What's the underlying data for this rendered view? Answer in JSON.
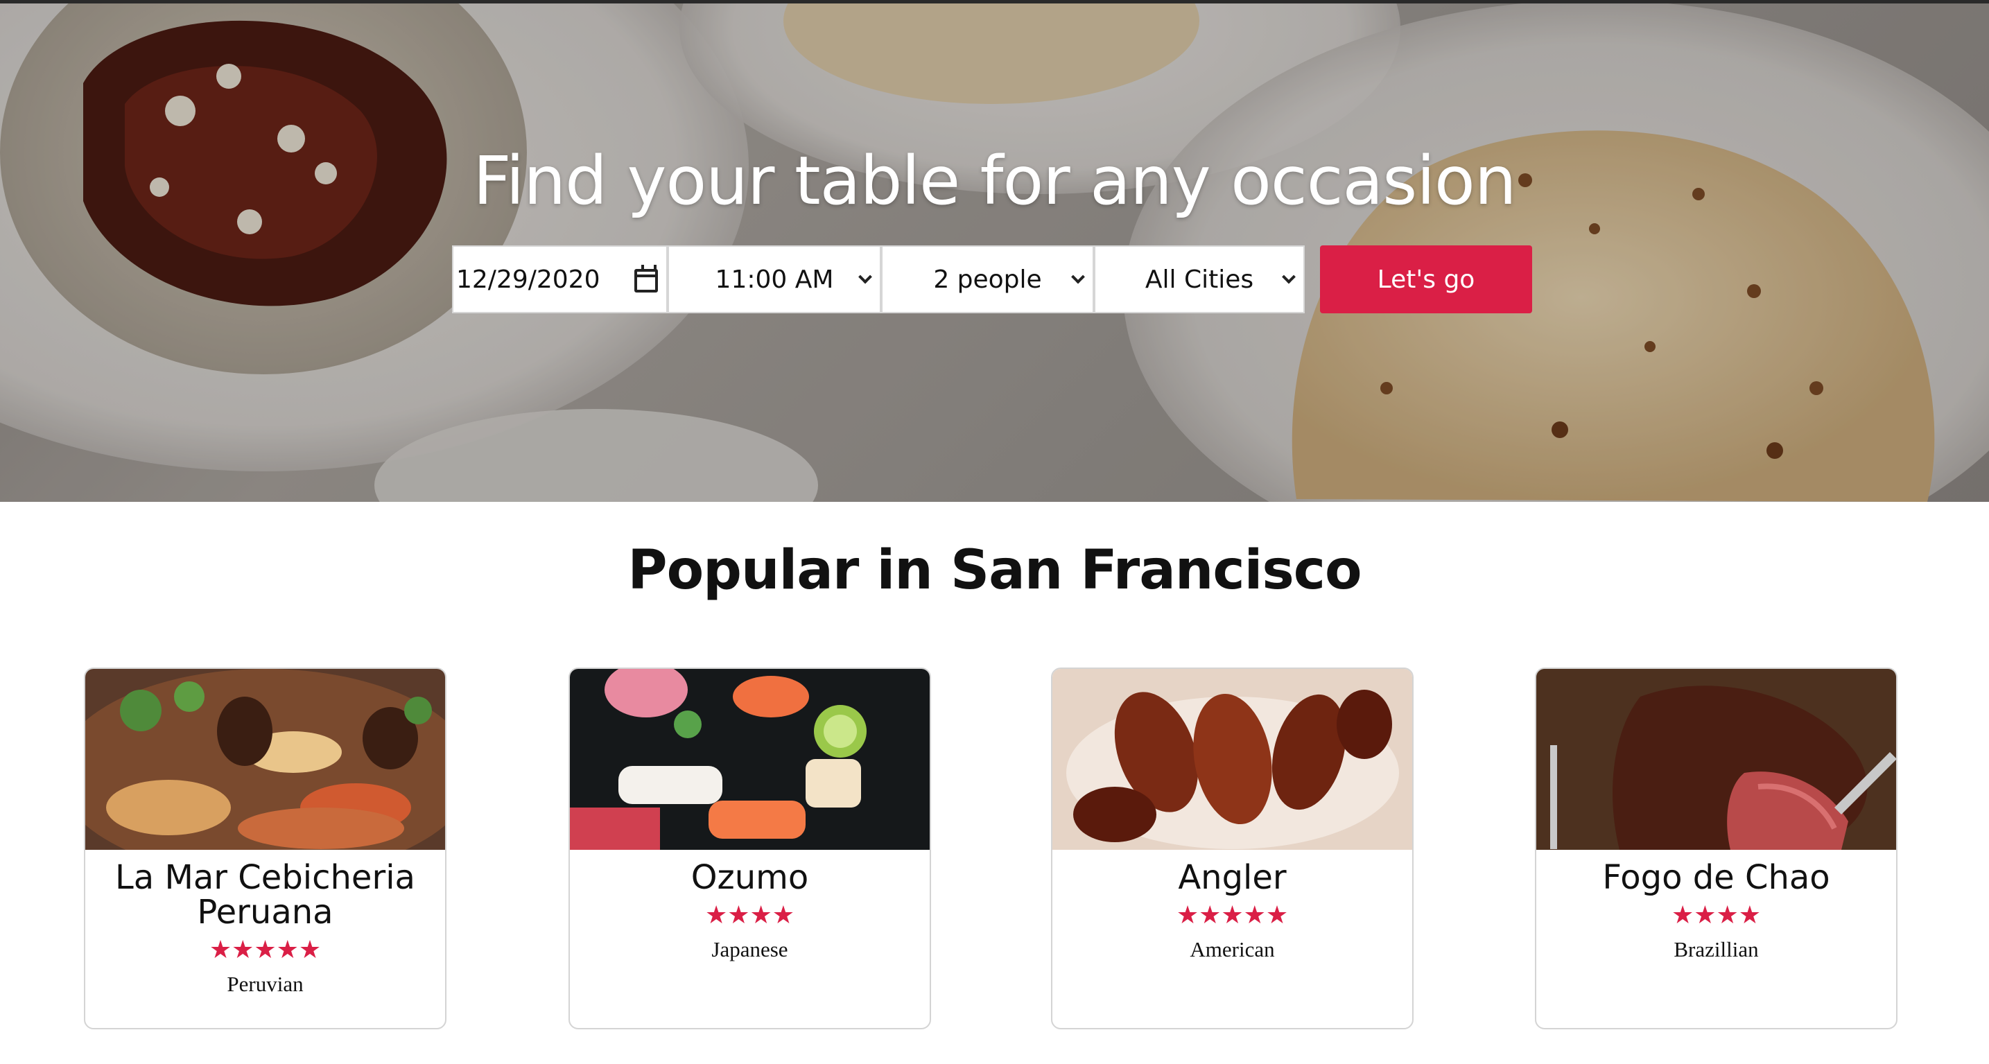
{
  "hero": {
    "title": "Find your table for any occasion",
    "date_value": "12/29/2020",
    "time_value": "11:00 AM",
    "party_value": "2 people",
    "city_value": "All Cities",
    "submit_label": "Let's go"
  },
  "section": {
    "title": "Popular in San Francisco"
  },
  "restaurants": [
    {
      "name": "La Mar Cebicheria Peruana",
      "rating": 5,
      "stars": "★★★★★",
      "cuisine": "Peruvian"
    },
    {
      "name": "Ozumo",
      "rating": 4,
      "stars": "★★★★",
      "cuisine": "Japanese"
    },
    {
      "name": "Angler",
      "rating": 5,
      "stars": "★★★★★",
      "cuisine": "American"
    },
    {
      "name": "Fogo de Chao",
      "rating": 4,
      "stars": "★★★★",
      "cuisine": "Brazillian"
    }
  ],
  "colors": {
    "accent": "#da1f46",
    "star": "#da1f46"
  },
  "icons": {
    "date_picker": "calendar-icon",
    "select": "chevron-down-icon"
  }
}
